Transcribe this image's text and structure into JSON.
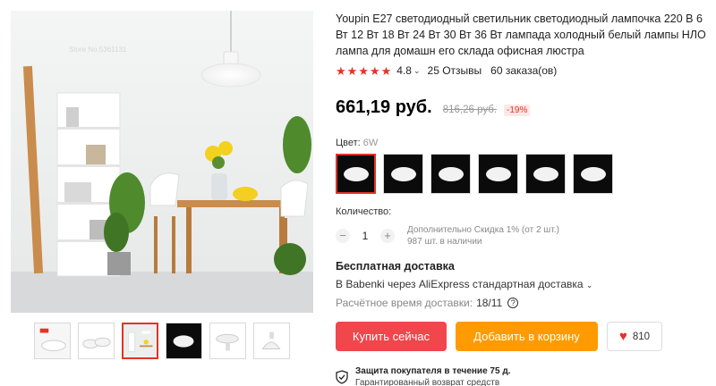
{
  "product": {
    "title": "Youpin E27 светодиодный светильник светодиодный лампочка 220 В 6 Вт 12 Вт 18 Вт 24 Вт 30 Вт 36 Вт лампада холодный белый лампы НЛО лампа для домашн его склада офисная люстра",
    "rating": "4.8",
    "reviews": "25 Отзывы",
    "orders": "60 заказа(ов)"
  },
  "gallery": {
    "watermark": "Store No.5361131",
    "thumbnails": [
      {
        "icon": "lamp-thumbnail-icon",
        "label": "Youpin"
      },
      {
        "icon": "lamp-thumbnail-icon"
      },
      {
        "icon": "room-thumbnail-icon"
      },
      {
        "icon": "lamp-dark-thumbnail-icon"
      },
      {
        "icon": "lamp-thumbnail-icon"
      },
      {
        "icon": "lamp-thumbnail-icon"
      }
    ],
    "active_thumbnail": 2
  },
  "price": {
    "current": "661,19 руб.",
    "old": "816,26 руб.",
    "discount": "-19%"
  },
  "color": {
    "label": "Цвет:",
    "value": "6W",
    "swatch_count": 6,
    "selected_index": 0
  },
  "quantity": {
    "label": "Количество:",
    "minus": "−",
    "plus": "+",
    "value": "1",
    "discount_note": "Дополнительно Скидка 1% (от 2 шт.)",
    "stock": "987 шт. в наличии"
  },
  "shipping": {
    "title": "Бесплатная доставка",
    "method": "В Babenki через AliExpress стандартная доставка",
    "time_label": "Расчётное время доставки:",
    "time_value": "18/11",
    "help": "?"
  },
  "actions": {
    "buy": "Купить сейчас",
    "cart": "Добавить в корзину",
    "wishlist_count": "810"
  },
  "protection": {
    "title": "Защита покупателя в течение 75 д.",
    "subtitle": "Гарантированный возврат средств"
  },
  "colors": {
    "accent": "#e43225",
    "buy_button": "#f0464c",
    "cart_button": "#ff9a00"
  }
}
